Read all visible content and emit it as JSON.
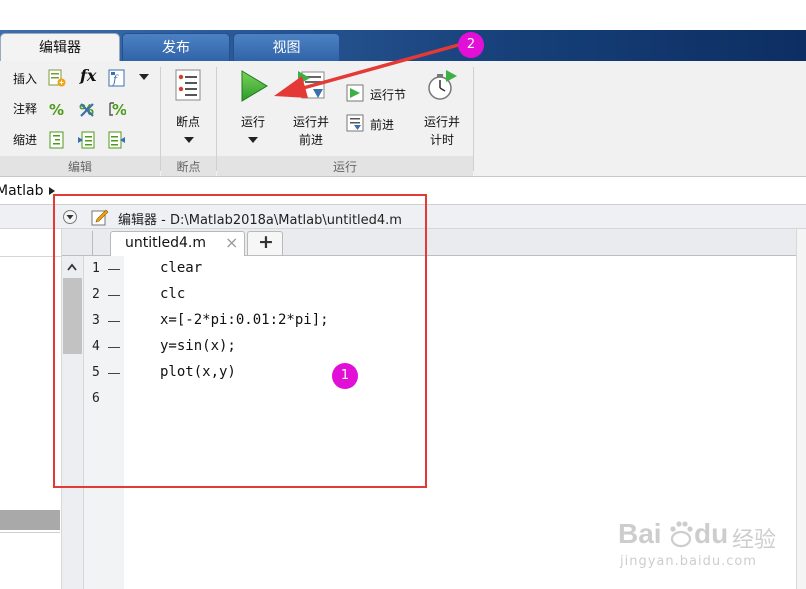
{
  "tabs": [
    {
      "label": "编辑器",
      "active": true
    },
    {
      "label": "发布",
      "active": false
    },
    {
      "label": "视图",
      "active": false
    }
  ],
  "ribbon": {
    "edit": {
      "insert": "插入",
      "comment": "注释",
      "indent": "缩进",
      "fx": "fx",
      "group": "编辑"
    },
    "breakpoint": {
      "label": "断点",
      "group": "断点"
    },
    "run": {
      "run": "运行",
      "run_advance_1": "运行并",
      "run_advance_2": "前进",
      "run_section": "运行节",
      "advance": "前进",
      "run_time_1": "运行并",
      "run_time_2": "计时",
      "group": "运行"
    }
  },
  "path": {
    "text": "Matlab"
  },
  "editor": {
    "title": "编辑器 - D:\\Matlab2018a\\Matlab\\untitled4.m",
    "file_tab": "untitled4.m",
    "close_symbol": "×",
    "add_symbol": "+",
    "line_numbers": [
      "1",
      "2",
      "3",
      "4",
      "5",
      "6"
    ],
    "lines": [
      "clear",
      "clc",
      "x=[-2*pi:0.01:2*pi];",
      "y=sin(x);",
      "plot(x,y)",
      ""
    ]
  },
  "annotations": {
    "badge1": "1",
    "badge2": "2"
  },
  "watermark": {
    "brand": "Bai",
    "brand_du": "du",
    "cn": "经验",
    "url": "jingyan.baidu.com"
  },
  "colors": {
    "accent_red": "#e53935",
    "badge": "#e20fd7",
    "run_green": "#3cb043",
    "ribbon_blue": "#2a5896"
  }
}
